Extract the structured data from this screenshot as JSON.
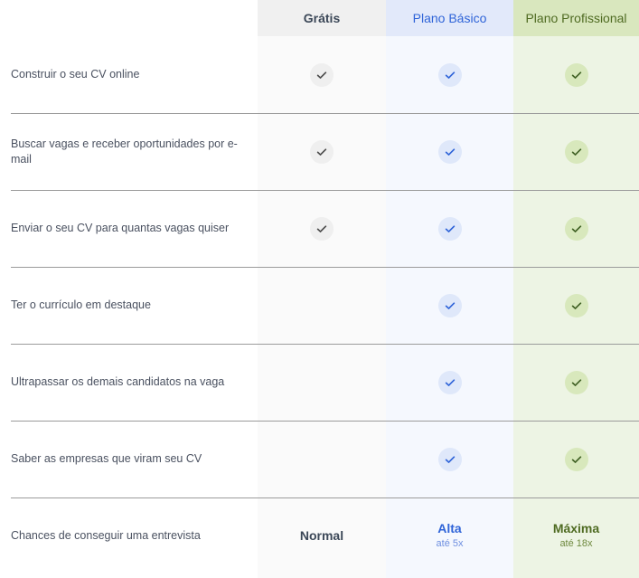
{
  "table": {
    "columns": [
      {
        "key": "feature",
        "label": ""
      },
      {
        "key": "free",
        "label": "Grátis",
        "accent": "#3c4858",
        "header_bg": "#f0f0f0",
        "body_bg": "#fafafa"
      },
      {
        "key": "basic",
        "label": "Plano Básico",
        "accent": "#2f64d8",
        "header_bg": "#e2e9fa",
        "body_bg": "#f5f8fe"
      },
      {
        "key": "pro",
        "label": "Plano Profissional",
        "accent": "#4f6b22",
        "header_bg": "#d9e7be",
        "body_bg": "#edf4e4"
      }
    ],
    "rows": [
      {
        "label": "Construir o seu CV online",
        "free": {
          "type": "check"
        },
        "basic": {
          "type": "check"
        },
        "pro": {
          "type": "check"
        }
      },
      {
        "label": "Buscar vagas e receber oportunidades por e-mail",
        "free": {
          "type": "check"
        },
        "basic": {
          "type": "check"
        },
        "pro": {
          "type": "check"
        }
      },
      {
        "label": "Enviar o seu CV para quantas vagas quiser",
        "free": {
          "type": "check"
        },
        "basic": {
          "type": "check"
        },
        "pro": {
          "type": "check"
        }
      },
      {
        "label": "Ter o currículo em destaque",
        "free": {
          "type": "none"
        },
        "basic": {
          "type": "check"
        },
        "pro": {
          "type": "check"
        }
      },
      {
        "label": "Ultrapassar os demais candidatos na vaga",
        "free": {
          "type": "none"
        },
        "basic": {
          "type": "check"
        },
        "pro": {
          "type": "check"
        }
      },
      {
        "label": "Saber as empresas que viram seu CV",
        "free": {
          "type": "none"
        },
        "basic": {
          "type": "check"
        },
        "pro": {
          "type": "check"
        }
      },
      {
        "label": "Chances de conseguir uma entrevista",
        "free": {
          "type": "text",
          "main": "Normal",
          "sub": ""
        },
        "basic": {
          "type": "text",
          "main": "Alta",
          "sub": "até 5x"
        },
        "pro": {
          "type": "text",
          "main": "Máxima",
          "sub": "até 18x"
        }
      }
    ],
    "icons": {
      "check": "check-icon"
    }
  }
}
